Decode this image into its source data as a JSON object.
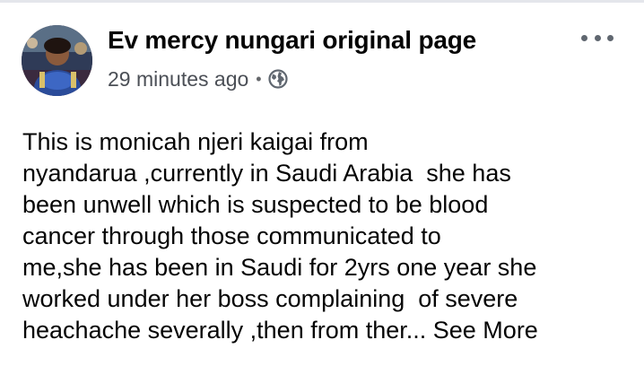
{
  "post": {
    "author": "Ev mercy nungari original page",
    "timestamp": "29 minutes ago",
    "separator": "•",
    "audience_icon": "globe-icon",
    "menu_icon": "more-options-icon",
    "body_lines": [
      "This is monicah njeri kaigai from",
      "nyandarua ,currently in Saudi Arabia  she has",
      "been unwell which is suspected to be blood",
      "cancer through those communicated to",
      "me,she has been in Saudi for 2yrs one year she",
      "worked under her boss complaining  of severe",
      "heachache severally ,then from ther..."
    ],
    "see_more": "See More"
  },
  "colors": {
    "text": "#050505",
    "secondary_text": "#4b4f56",
    "icon": "#606770",
    "divider": "#e4e6eb"
  }
}
